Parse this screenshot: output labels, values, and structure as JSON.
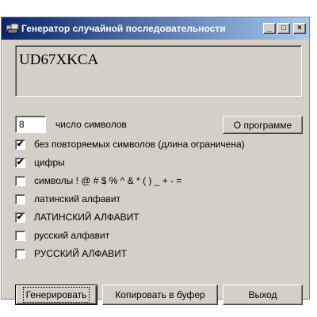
{
  "window": {
    "title": "Генератор случайной последовательности",
    "minimize_glyph": "_",
    "maximize_glyph": "□",
    "close_glyph": "×"
  },
  "output": {
    "value": "UD67XKCA"
  },
  "length": {
    "value": "8",
    "label": "число символов"
  },
  "about_button": "О программе",
  "options": [
    {
      "label": "без повторяемых символов (длина ограничена)",
      "checked": true
    },
    {
      "label": "цифры",
      "checked": true
    },
    {
      "label": "символы ! @ # $ % ^ & * ( ) _ + - =",
      "checked": false
    },
    {
      "label": "латинский алфавит",
      "checked": false
    },
    {
      "label": "ЛАТИНСКИЙ АЛФАВИТ",
      "checked": true
    },
    {
      "label": "русский алфавит",
      "checked": false
    },
    {
      "label": "РУССКИЙ АЛФАВИТ",
      "checked": false
    }
  ],
  "buttons": {
    "generate": "Генерировать",
    "copy": "Копировать в буфер",
    "exit": "Выход"
  },
  "icons": {
    "app": "app-icon",
    "check": "✔"
  }
}
